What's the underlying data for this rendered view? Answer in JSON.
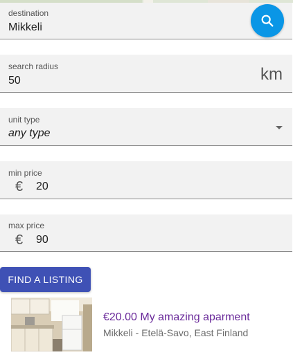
{
  "form": {
    "destination": {
      "label": "destination",
      "value": "Mikkeli"
    },
    "radius": {
      "label": "search radius",
      "value": "50",
      "unit": "km"
    },
    "unit_type": {
      "label": "unit type",
      "value": "any type"
    },
    "min_price": {
      "label": "min price",
      "currency": "€",
      "value": "20"
    },
    "max_price": {
      "label": "max price",
      "currency": "€",
      "value": "90"
    }
  },
  "buttons": {
    "find_listing": "FIND A LISTING",
    "search_icon": "search-icon"
  },
  "listings": [
    {
      "price_title": "€20.00 My amazing aparment",
      "location": "Mikkeli - Etelä-Savo, East Finland"
    }
  ],
  "colors": {
    "search_button": "#0a96e6",
    "primary_button": "#3f51b5",
    "listing_title": "#6a2a9a"
  }
}
